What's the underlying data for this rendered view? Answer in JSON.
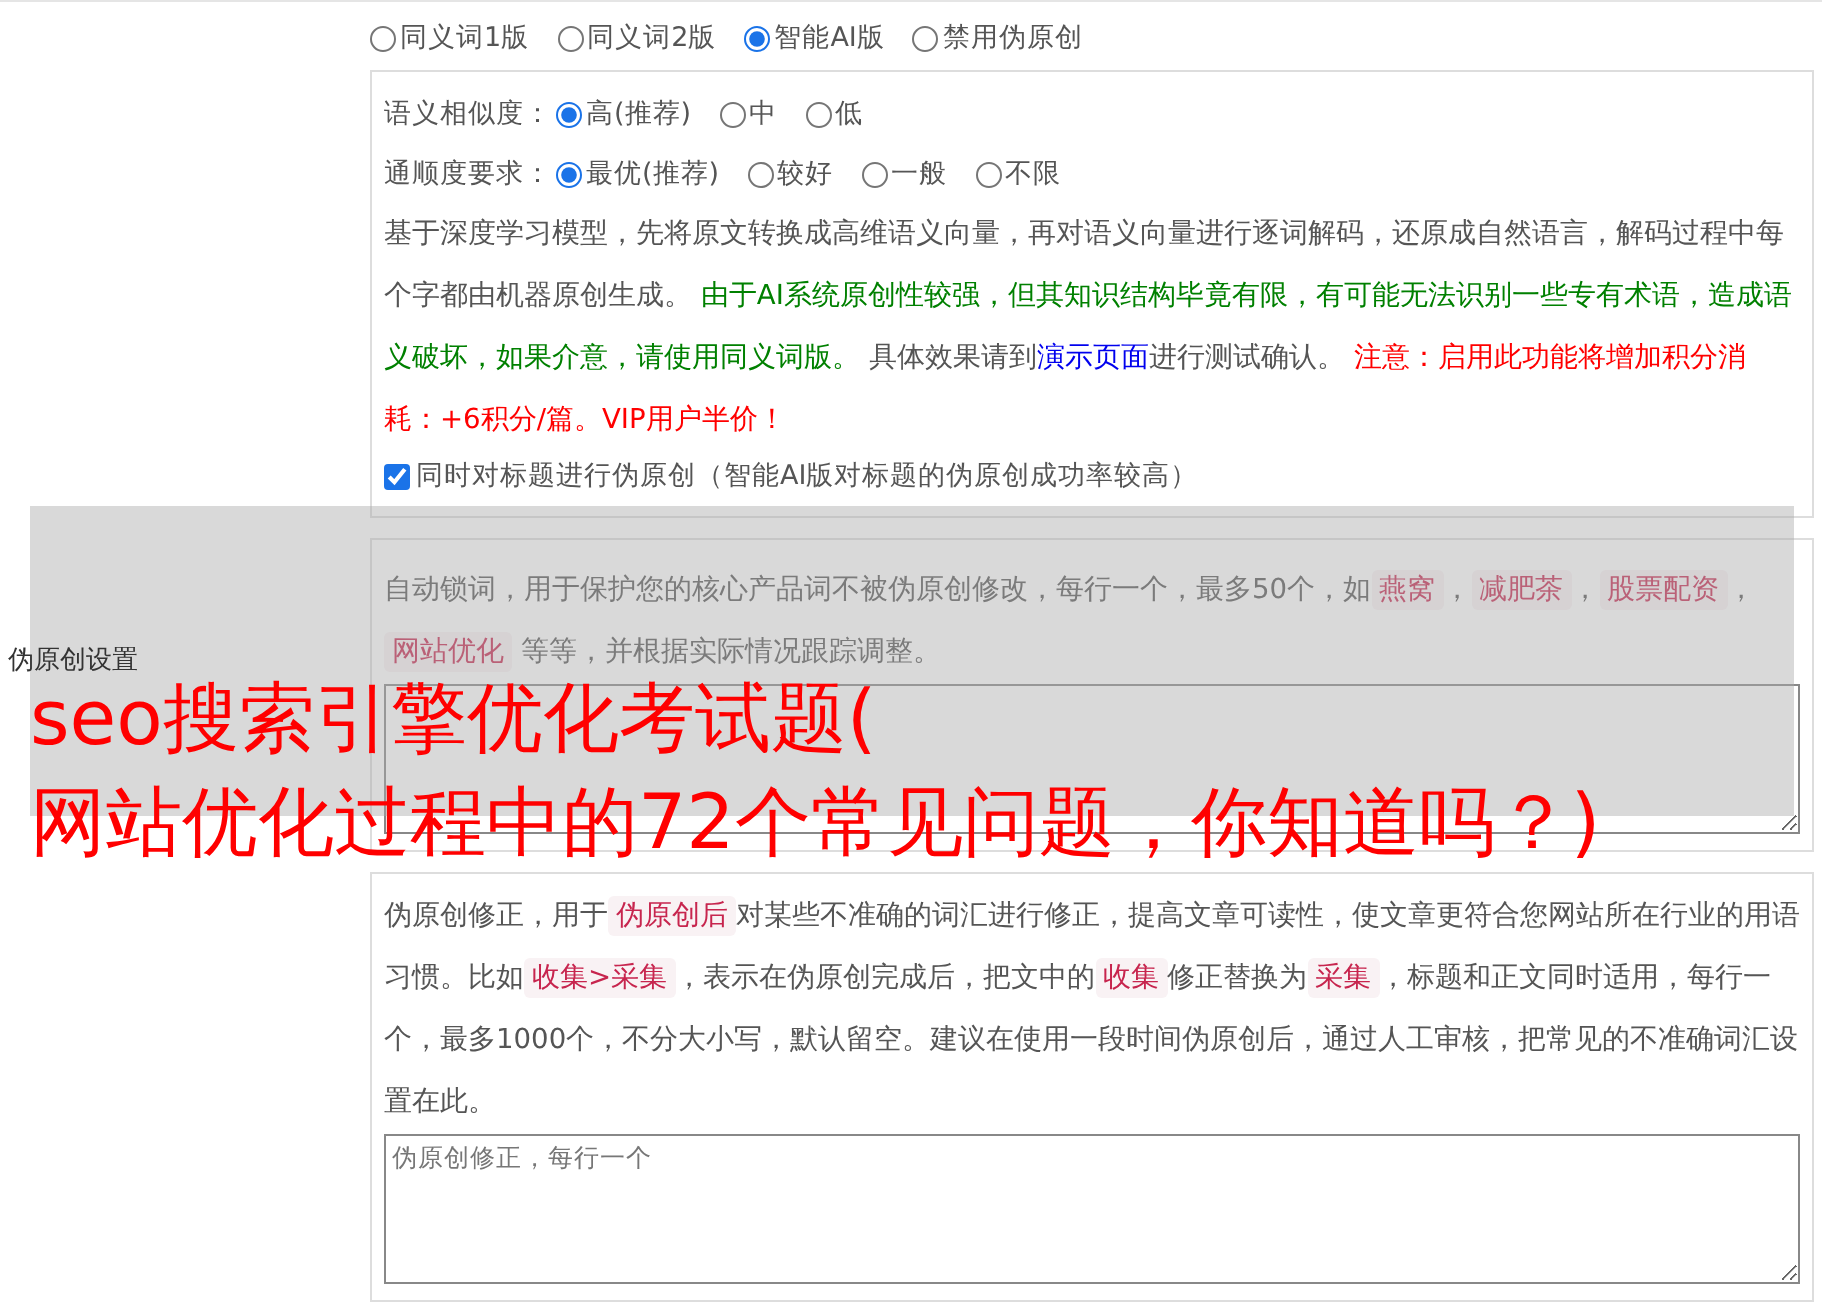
{
  "setting_label": "伪原创设置",
  "modes": [
    {
      "label": "同义词1版",
      "selected": false
    },
    {
      "label": "同义词2版",
      "selected": false
    },
    {
      "label": "智能AI版",
      "selected": true
    },
    {
      "label": "禁用伪原创",
      "selected": false
    }
  ],
  "ai_options": {
    "groups": [
      {
        "label": "语义相似度：",
        "options": [
          {
            "label": "高(推荐)",
            "selected": true
          },
          {
            "label": "中",
            "selected": false
          },
          {
            "label": "低",
            "selected": false
          }
        ]
      },
      {
        "label": "通顺度要求：",
        "options": [
          {
            "label": "最优(推荐)",
            "selected": true
          },
          {
            "label": "较好",
            "selected": false
          },
          {
            "label": "一般",
            "selected": false
          },
          {
            "label": "不限",
            "selected": false
          }
        ]
      }
    ],
    "description": [
      {
        "kind": "plain",
        "text": "基于深度学习模型，先将原文转换成高维语义向量，再对语义向量进行逐词解码，还原成自然语言，解码过程中每个字都由机器原创生成。 "
      },
      {
        "kind": "green",
        "text": "由于AI系统原创性较强，但其知识结构毕竟有限，有可能无法识别一些专有术语，造成语义破坏，如果介意，请使用同义词版。"
      },
      {
        "kind": "plain",
        "text": " 具体效果请到"
      },
      {
        "kind": "link",
        "text": "演示页面"
      },
      {
        "kind": "plain",
        "text": "进行测试确认。 "
      },
      {
        "kind": "red",
        "text": "注意：启用此功能将增加积分消耗：+6积分/篇。VIP用户半价！"
      }
    ],
    "title_checkbox": {
      "label": "同时对标题进行伪原创（智能AI版对标题的伪原创成功率较高）",
      "checked": true
    }
  },
  "lock_words": {
    "description": [
      {
        "kind": "plain",
        "text": "自动锁词，用于保护您的核心产品词不被伪原创修改，每行一个，最多50个，如"
      },
      {
        "kind": "code",
        "text": "燕窝"
      },
      {
        "kind": "plain",
        "text": "，"
      },
      {
        "kind": "code",
        "text": "减肥茶"
      },
      {
        "kind": "plain",
        "text": "，"
      },
      {
        "kind": "code",
        "text": "股票配资"
      },
      {
        "kind": "plain",
        "text": "，"
      },
      {
        "kind": "code",
        "text": "网站优化"
      },
      {
        "kind": "plain",
        "text": " 等等，并根据实际情况跟踪调整。"
      }
    ]
  },
  "corrections": {
    "description": [
      {
        "kind": "plain",
        "text": "伪原创修正，用于"
      },
      {
        "kind": "code",
        "text": "伪原创后"
      },
      {
        "kind": "plain",
        "text": "对某些不准确的词汇进行修正，提高文章可读性，使文章更符合您网站所在行业的用语习惯。比如"
      },
      {
        "kind": "code",
        "text": "收集>采集"
      },
      {
        "kind": "plain",
        "text": "，表示在伪原创完成后，把文中的"
      },
      {
        "kind": "code",
        "text": "收集"
      },
      {
        "kind": "plain",
        "text": "修正替换为"
      },
      {
        "kind": "code",
        "text": "采集"
      },
      {
        "kind": "plain",
        "text": "，标题和正文同时适用，每行一个，最多1000个，不分大小写，默认留空。建议在使用一段时间伪原创后，通过人工审核，把常见的不准确词汇设置在此。"
      }
    ],
    "placeholder": "伪原创修正，每行一个"
  },
  "overlay_title": [
    "seo搜索引擎优化考试题(",
    "网站优化过程中的72个常见问题，你知道吗？)"
  ]
}
